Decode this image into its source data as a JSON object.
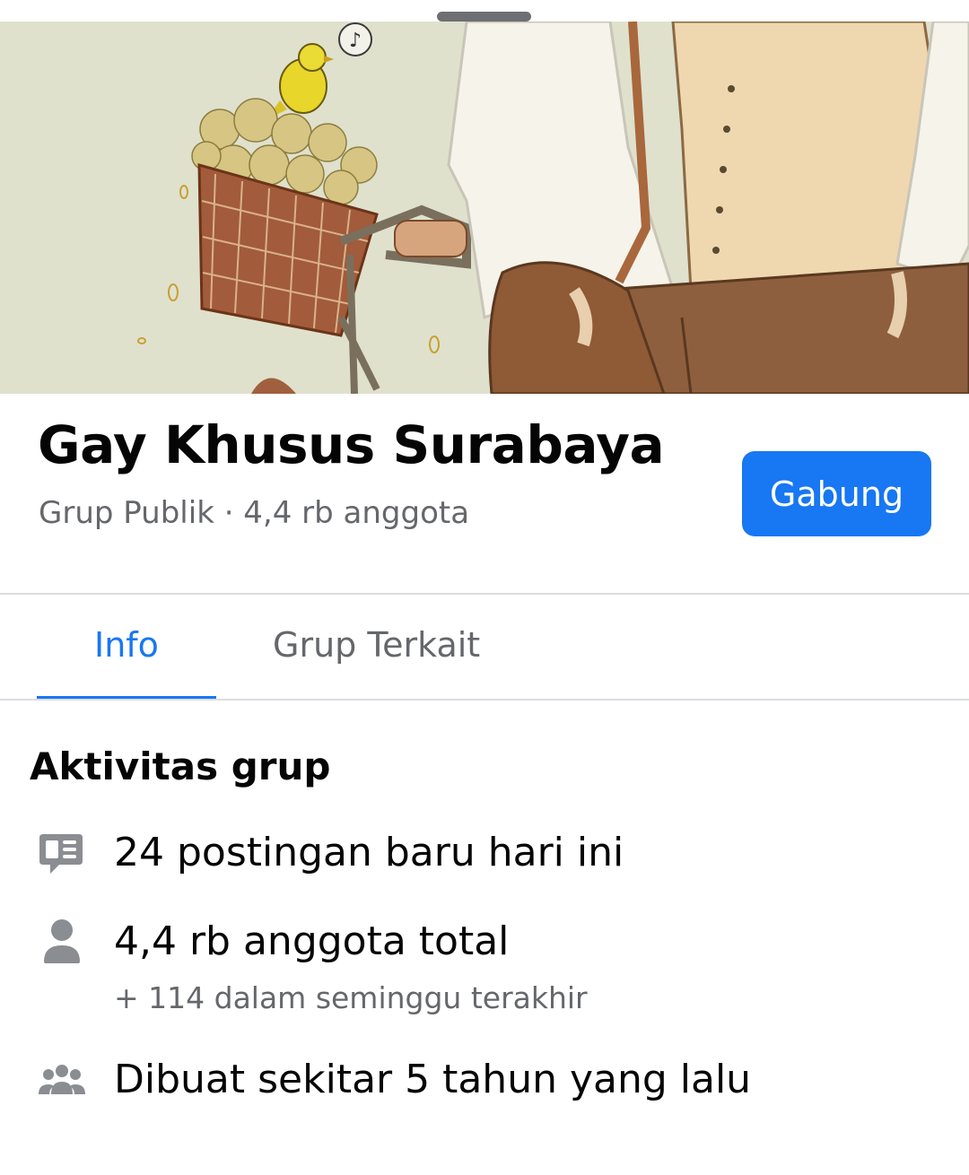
{
  "group": {
    "name": "Gay Khusus Surabaya",
    "meta": "Grup Publik · 4,4 rb anggota",
    "join_label": "Gabung"
  },
  "tabs": [
    {
      "label": "Info",
      "active": true
    },
    {
      "label": "Grup Terkait",
      "active": false
    }
  ],
  "activity": {
    "title": "Aktivitas grup",
    "items": [
      {
        "icon": "posts-icon",
        "text": "24 postingan baru hari ini"
      },
      {
        "icon": "person-icon",
        "text": "4,4 rb anggota total",
        "sub": "+ 114 dalam seminggu terakhir"
      },
      {
        "icon": "group-people-icon",
        "text": "Dibuat sekitar 5 tahun yang lalu"
      }
    ]
  },
  "colors": {
    "accent": "#1877f2",
    "secondary_text": "#65676b",
    "primary_text": "#050505",
    "icon": "#8a8d91"
  },
  "cover": {
    "icon": "cover-photo-illustration"
  }
}
